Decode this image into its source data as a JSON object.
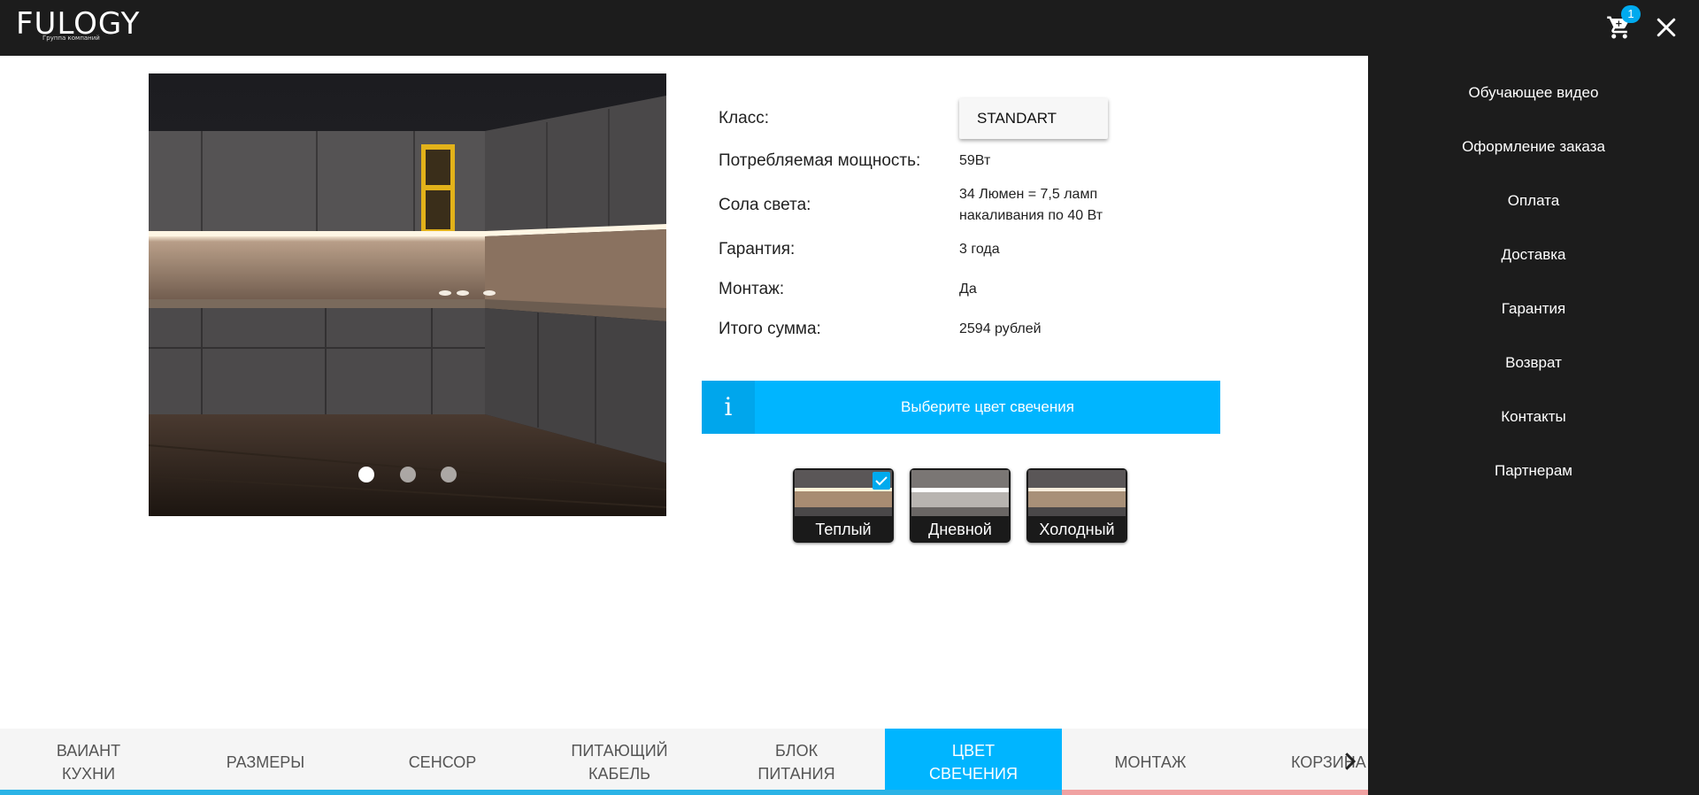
{
  "header": {
    "logo": "FULOGY",
    "logo_subtitle": "Группа компаний",
    "cart_count": "1",
    "icons": [
      "cart-icon",
      "close-icon"
    ]
  },
  "side_menu": {
    "items": [
      "Обучающее видео",
      "Оформление заказа",
      "Оплата",
      "Доставка",
      "Гарантия",
      "Возврат",
      "Контакты",
      "Партнерам"
    ]
  },
  "slider": {
    "slides": 3,
    "active": 1
  },
  "specs": [
    {
      "label": "Класс:",
      "value": "STANDART"
    },
    {
      "label": "Потребляемая мощность:",
      "value": "59Вт"
    },
    {
      "label": "Сола света:",
      "value": "34 Люмен = 7,5 ламп накаливания по 40 Вт"
    },
    {
      "label": "Гарантия:",
      "value": "3 года"
    },
    {
      "label": "Монтаж:",
      "value": "Да"
    },
    {
      "label": "Итого сумма:",
      "value": "2594 рублей"
    }
  ],
  "info": {
    "icon": "i",
    "text": "Выберите цвет свечения"
  },
  "colors": [
    {
      "label": "Теплый",
      "selected": true
    },
    {
      "label": "Дневной",
      "selected": false
    },
    {
      "label": "Холодный",
      "selected": false
    }
  ],
  "tabs": [
    {
      "label": "ВАИАНТ\nКУХНИ",
      "active": false
    },
    {
      "label": "РАЗМЕРЫ",
      "active": false
    },
    {
      "label": "СЕНСОР",
      "active": false
    },
    {
      "label": "ПИТАЮЩИЙ\nКАБЕЛЬ",
      "active": false
    },
    {
      "label": "БЛОК\nПИТАНИЯ",
      "active": false
    },
    {
      "label": "ЦВЕТ\nСВЕЧЕНИЯ",
      "active": true
    },
    {
      "label": "МОНТАЖ",
      "active": false
    },
    {
      "label": "КОРЗИНА",
      "active": false
    }
  ],
  "theme": {
    "accent": "#00b5ff",
    "dark": "#1c1c1c",
    "progress_done": "#2bb3e6",
    "progress_remaining": "#f0a2a2"
  }
}
